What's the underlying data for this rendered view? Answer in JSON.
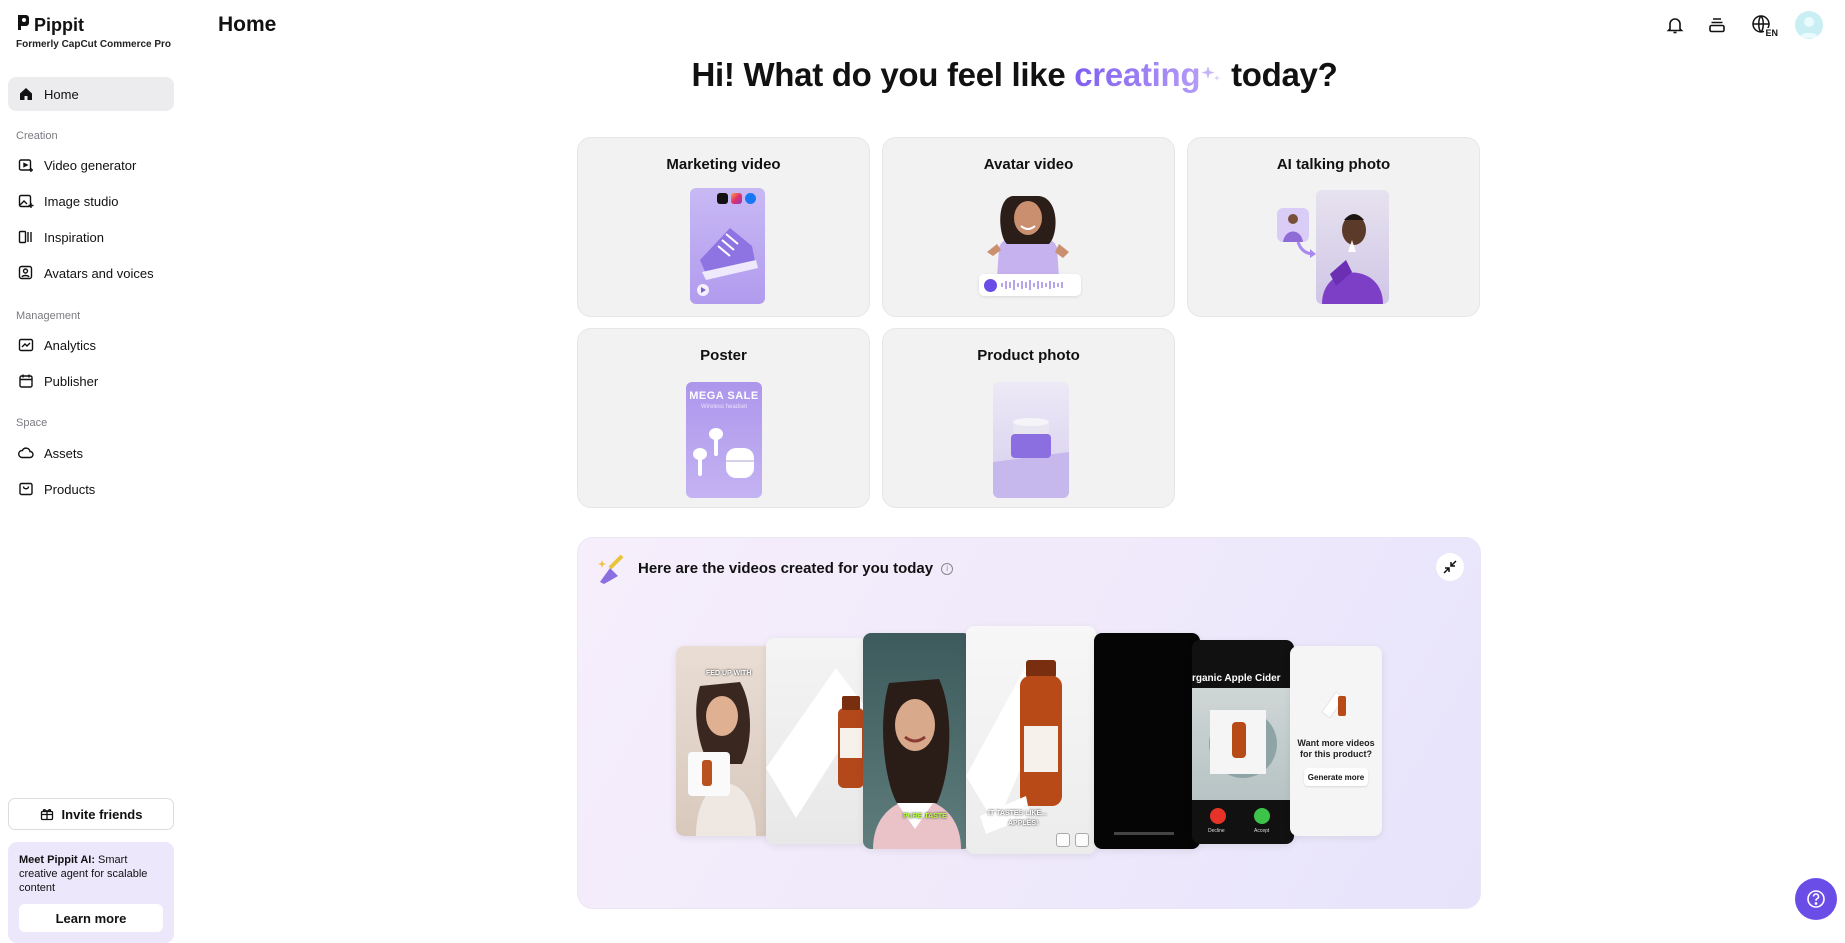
{
  "brand": {
    "name": "Pippit",
    "subtitle": "Formerly CapCut Commerce Pro"
  },
  "header": {
    "title": "Home"
  },
  "sidebar": {
    "home": "Home",
    "sections": {
      "creation": "Creation",
      "management": "Management",
      "space": "Space"
    },
    "creation_items": [
      "Video generator",
      "Image studio",
      "Inspiration",
      "Avatars and voices"
    ],
    "management_items": [
      "Analytics",
      "Publisher"
    ],
    "space_items": [
      "Assets",
      "Products"
    ],
    "invite_label": "Invite friends",
    "promo": {
      "bold": "Meet Pippit AI:",
      "text": " Smart creative agent for scalable content",
      "button": "Learn more"
    }
  },
  "topbar": {
    "language_badge": "EN"
  },
  "headline": {
    "before": "Hi! What do you feel like ",
    "highlight": "creating",
    "after": " today?"
  },
  "cards": {
    "marketing_video": "Marketing video",
    "avatar_video": "Avatar video",
    "ai_talking_photo": "AI talking photo",
    "poster": "Poster",
    "product_photo": "Product photo",
    "poster_sale_text": "MEGA SALE",
    "poster_sub_text": "Wireless headset"
  },
  "videos_panel": {
    "title": "Here are the videos created for you today",
    "captions": {
      "fed_up": "FED UP WITH",
      "pure_taste": "PURE TASTE",
      "tastes_like": "IT TASTES LIKE...",
      "apples": "APPLES!",
      "organic": "rganic Apple Cider",
      "decline": "Decline",
      "accept": "Accept"
    },
    "more_prompt": "Want more videos for this product?",
    "generate_more": "Generate more"
  },
  "colors": {
    "accent": "#6a4de6",
    "highlight_start": "#7f5ef0",
    "highlight_end": "#b49bf7",
    "card_bg": "#f2f2f3",
    "lavender": "#b9a6f2"
  }
}
